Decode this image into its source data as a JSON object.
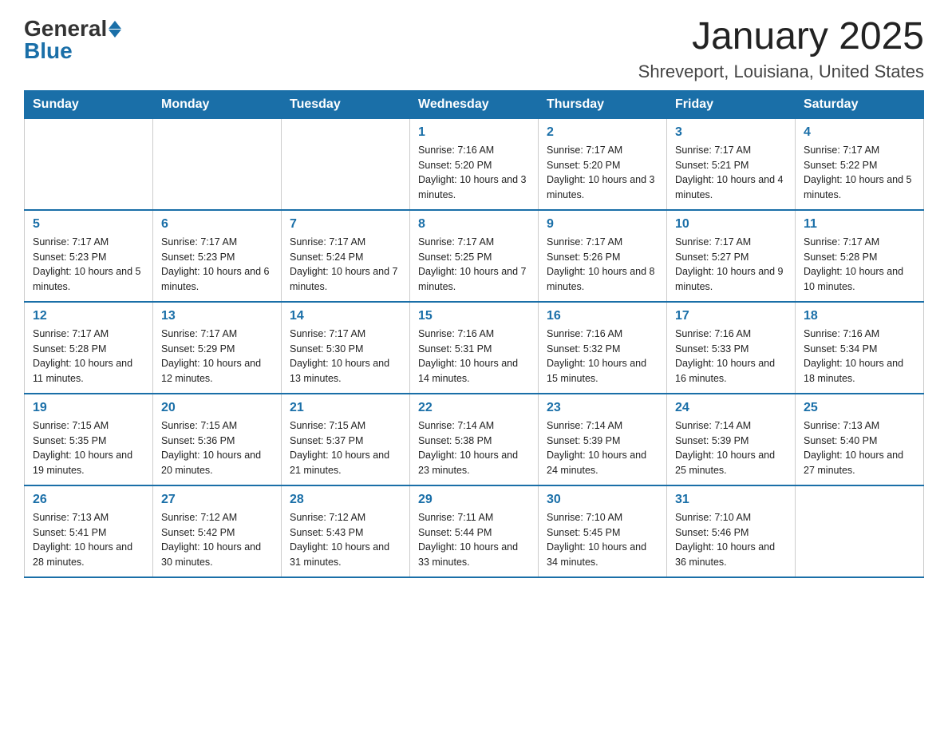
{
  "header": {
    "logo_general": "General",
    "logo_blue": "Blue",
    "title": "January 2025",
    "subtitle": "Shreveport, Louisiana, United States"
  },
  "weekdays": [
    "Sunday",
    "Monday",
    "Tuesday",
    "Wednesday",
    "Thursday",
    "Friday",
    "Saturday"
  ],
  "weeks": [
    [
      {
        "day": "",
        "info": ""
      },
      {
        "day": "",
        "info": ""
      },
      {
        "day": "",
        "info": ""
      },
      {
        "day": "1",
        "info": "Sunrise: 7:16 AM\nSunset: 5:20 PM\nDaylight: 10 hours and 3 minutes."
      },
      {
        "day": "2",
        "info": "Sunrise: 7:17 AM\nSunset: 5:20 PM\nDaylight: 10 hours and 3 minutes."
      },
      {
        "day": "3",
        "info": "Sunrise: 7:17 AM\nSunset: 5:21 PM\nDaylight: 10 hours and 4 minutes."
      },
      {
        "day": "4",
        "info": "Sunrise: 7:17 AM\nSunset: 5:22 PM\nDaylight: 10 hours and 5 minutes."
      }
    ],
    [
      {
        "day": "5",
        "info": "Sunrise: 7:17 AM\nSunset: 5:23 PM\nDaylight: 10 hours and 5 minutes."
      },
      {
        "day": "6",
        "info": "Sunrise: 7:17 AM\nSunset: 5:23 PM\nDaylight: 10 hours and 6 minutes."
      },
      {
        "day": "7",
        "info": "Sunrise: 7:17 AM\nSunset: 5:24 PM\nDaylight: 10 hours and 7 minutes."
      },
      {
        "day": "8",
        "info": "Sunrise: 7:17 AM\nSunset: 5:25 PM\nDaylight: 10 hours and 7 minutes."
      },
      {
        "day": "9",
        "info": "Sunrise: 7:17 AM\nSunset: 5:26 PM\nDaylight: 10 hours and 8 minutes."
      },
      {
        "day": "10",
        "info": "Sunrise: 7:17 AM\nSunset: 5:27 PM\nDaylight: 10 hours and 9 minutes."
      },
      {
        "day": "11",
        "info": "Sunrise: 7:17 AM\nSunset: 5:28 PM\nDaylight: 10 hours and 10 minutes."
      }
    ],
    [
      {
        "day": "12",
        "info": "Sunrise: 7:17 AM\nSunset: 5:28 PM\nDaylight: 10 hours and 11 minutes."
      },
      {
        "day": "13",
        "info": "Sunrise: 7:17 AM\nSunset: 5:29 PM\nDaylight: 10 hours and 12 minutes."
      },
      {
        "day": "14",
        "info": "Sunrise: 7:17 AM\nSunset: 5:30 PM\nDaylight: 10 hours and 13 minutes."
      },
      {
        "day": "15",
        "info": "Sunrise: 7:16 AM\nSunset: 5:31 PM\nDaylight: 10 hours and 14 minutes."
      },
      {
        "day": "16",
        "info": "Sunrise: 7:16 AM\nSunset: 5:32 PM\nDaylight: 10 hours and 15 minutes."
      },
      {
        "day": "17",
        "info": "Sunrise: 7:16 AM\nSunset: 5:33 PM\nDaylight: 10 hours and 16 minutes."
      },
      {
        "day": "18",
        "info": "Sunrise: 7:16 AM\nSunset: 5:34 PM\nDaylight: 10 hours and 18 minutes."
      }
    ],
    [
      {
        "day": "19",
        "info": "Sunrise: 7:15 AM\nSunset: 5:35 PM\nDaylight: 10 hours and 19 minutes."
      },
      {
        "day": "20",
        "info": "Sunrise: 7:15 AM\nSunset: 5:36 PM\nDaylight: 10 hours and 20 minutes."
      },
      {
        "day": "21",
        "info": "Sunrise: 7:15 AM\nSunset: 5:37 PM\nDaylight: 10 hours and 21 minutes."
      },
      {
        "day": "22",
        "info": "Sunrise: 7:14 AM\nSunset: 5:38 PM\nDaylight: 10 hours and 23 minutes."
      },
      {
        "day": "23",
        "info": "Sunrise: 7:14 AM\nSunset: 5:39 PM\nDaylight: 10 hours and 24 minutes."
      },
      {
        "day": "24",
        "info": "Sunrise: 7:14 AM\nSunset: 5:39 PM\nDaylight: 10 hours and 25 minutes."
      },
      {
        "day": "25",
        "info": "Sunrise: 7:13 AM\nSunset: 5:40 PM\nDaylight: 10 hours and 27 minutes."
      }
    ],
    [
      {
        "day": "26",
        "info": "Sunrise: 7:13 AM\nSunset: 5:41 PM\nDaylight: 10 hours and 28 minutes."
      },
      {
        "day": "27",
        "info": "Sunrise: 7:12 AM\nSunset: 5:42 PM\nDaylight: 10 hours and 30 minutes."
      },
      {
        "day": "28",
        "info": "Sunrise: 7:12 AM\nSunset: 5:43 PM\nDaylight: 10 hours and 31 minutes."
      },
      {
        "day": "29",
        "info": "Sunrise: 7:11 AM\nSunset: 5:44 PM\nDaylight: 10 hours and 33 minutes."
      },
      {
        "day": "30",
        "info": "Sunrise: 7:10 AM\nSunset: 5:45 PM\nDaylight: 10 hours and 34 minutes."
      },
      {
        "day": "31",
        "info": "Sunrise: 7:10 AM\nSunset: 5:46 PM\nDaylight: 10 hours and 36 minutes."
      },
      {
        "day": "",
        "info": ""
      }
    ]
  ]
}
